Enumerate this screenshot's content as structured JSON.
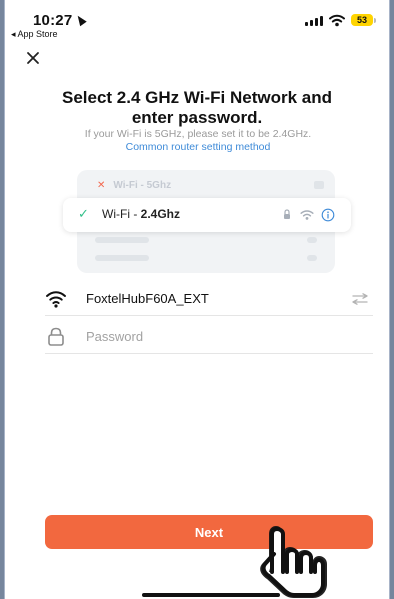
{
  "status_bar": {
    "time": "10:27",
    "back_app": "◂ App Store",
    "battery": "53"
  },
  "header": {
    "close_icon": "close-icon"
  },
  "main": {
    "title": "Select 2.4 GHz Wi-Fi Network and enter password.",
    "subtitle": "If your Wi-Fi is 5GHz, please set it to be 2.4GHz.",
    "router_link": "Common router setting method"
  },
  "illustration": {
    "top_prefix": "Wi-Fi - ",
    "top_band": "5Ghz",
    "selected_prefix": "Wi-Fi - ",
    "selected_band": "2.4Ghz",
    "icons": [
      "check-icon",
      "lock-icon",
      "wifi-icon",
      "info-icon"
    ]
  },
  "form": {
    "ssid": "FoxtelHubF60A_EXT",
    "password_placeholder": "Password",
    "password_value": ""
  },
  "actions": {
    "next_label": "Next"
  },
  "colors": {
    "accent": "#f2683f",
    "link": "#3f8bd8",
    "success": "#33c08a",
    "battery": "#ffd400"
  }
}
